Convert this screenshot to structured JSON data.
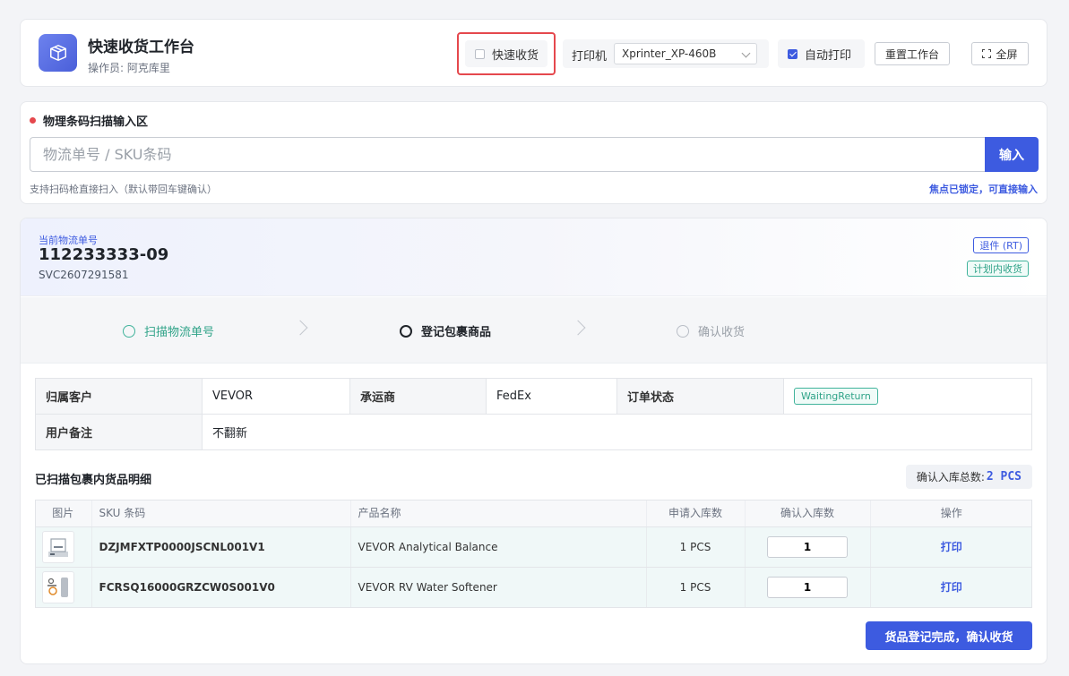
{
  "header": {
    "title": "快速收货工作台",
    "operator": "操作员: 阿克库里",
    "quick_receive_label": "快速收货",
    "quick_receive_checked": false,
    "printer_label": "打印机",
    "printer_value": "Xprinter_XP-460B",
    "auto_print_label": "自动打印",
    "auto_print_checked": true,
    "reset_label": "重置工作台",
    "fullscreen_label": "全屏"
  },
  "scan": {
    "title": "物理条码扫描输入区",
    "placeholder": "物流单号 / SKU条码",
    "submit_label": "输入",
    "hint": "支持扫码枪直接扫入（默认带回车键确认）",
    "focus_status": "焦点已锁定，可直接输入"
  },
  "shipment": {
    "current_label": "当前物流单号",
    "tracking_no": "112233333-09",
    "sub_no": "SVC2607291581",
    "tag_type": "退件 (RT)",
    "tag_plan": "计划内收货"
  },
  "steps": [
    {
      "label": "扫描物流单号",
      "state": "done"
    },
    {
      "label": "登记包裹商品",
      "state": "active"
    },
    {
      "label": "确认收货",
      "state": "pending"
    }
  ],
  "info": {
    "customer_label": "归属客户",
    "customer_value": "VEVOR",
    "carrier_label": "承运商",
    "carrier_value": "FedEx",
    "status_label": "订单状态",
    "status_value": "WaitingReturn",
    "remark_label": "用户备注",
    "remark_value": "不翻新"
  },
  "items": {
    "title": "已扫描包裹内货品明细",
    "total_label": "确认入库总数:",
    "total_value": "2 PCS",
    "columns": [
      "图片",
      "SKU 条码",
      "产品名称",
      "申请入库数",
      "确认入库数",
      "操作"
    ],
    "rows": [
      {
        "sku": "DZJMFXTP0000JSCNL001V1",
        "name": "VEVOR Analytical Balance",
        "requested": "1 PCS",
        "confirmed": "1",
        "action": "打印"
      },
      {
        "sku": "FCRSQ16000GRZCW0S001V0",
        "name": "VEVOR RV Water Softener",
        "requested": "1 PCS",
        "confirmed": "1",
        "action": "打印"
      }
    ]
  },
  "confirm_label": "货品登记完成，确认收货",
  "colors": {
    "accent": "#3d5be0",
    "highlight_border": "#e5484d",
    "success": "#2fa388"
  }
}
